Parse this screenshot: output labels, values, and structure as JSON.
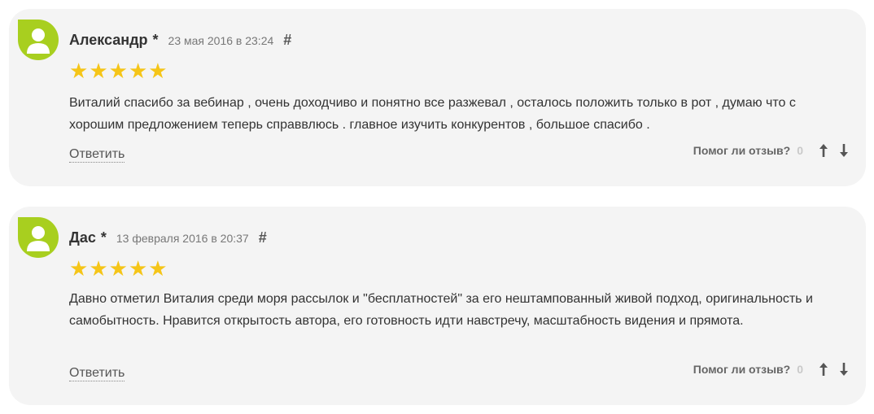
{
  "reviews": [
    {
      "author": "Александр",
      "marker": "*",
      "date": "23 мая 2016 в 23:24",
      "hash": "#",
      "rating": 5,
      "stars": "★★★★★",
      "text": "Виталий спасибо за вебинар , очень доходчиво и понятно все разжевал , осталось положить только в рот , думаю что с хорошим предложением теперь справвлюсь . главное изучить конкурентов , большое спасибо .",
      "reply_label": "Ответить",
      "helpful_label": "Помог ли отзыв?",
      "helpful_count": "0"
    },
    {
      "author": "Дас",
      "marker": "*",
      "date": "13 февраля 2016 в 20:37",
      "hash": "#",
      "rating": 5,
      "stars": "★★★★★",
      "text": "Давно отметил Виталия среди моря рассылок и \"бесплатностей\" за его нештампованный живой подход, оригинальность и самобытность. Нравится открытость автора, его готовность идти навстречу, масштабность видения и прямота.",
      "reply_label": "Ответить",
      "helpful_label": "Помог ли отзыв?",
      "helpful_count": "0"
    }
  ],
  "colors": {
    "card_background": "#f4f4f4",
    "avatar_green": "#a8cf1f",
    "star_yellow": "#f5c518"
  },
  "icons": {
    "avatar": "user-silhouette-icon",
    "upvote": "arrow-up-icon",
    "downvote": "arrow-down-icon"
  }
}
